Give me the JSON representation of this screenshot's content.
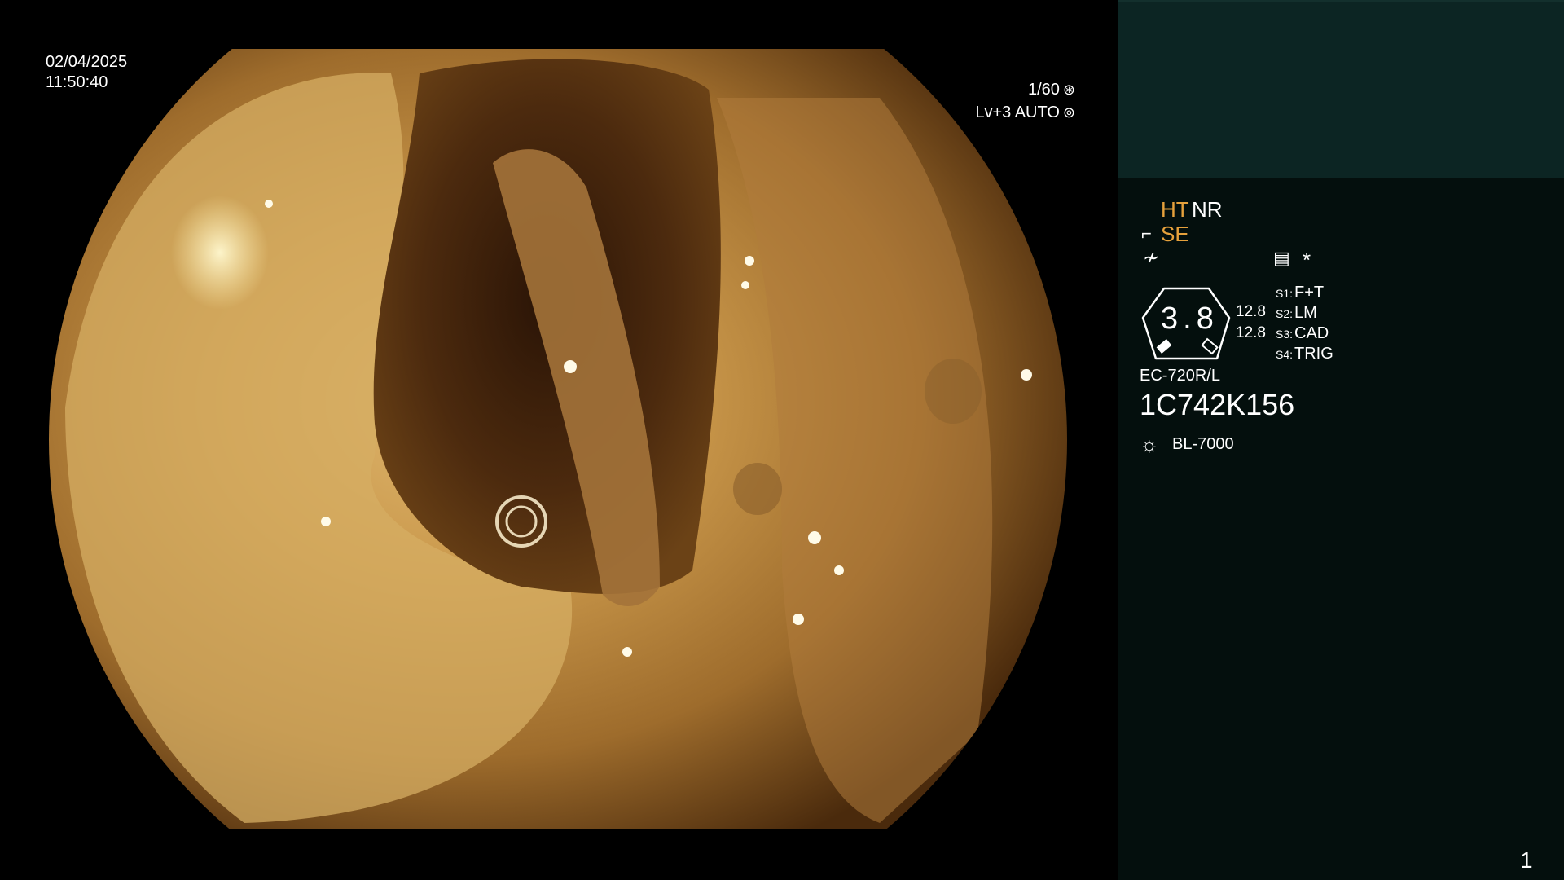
{
  "endoscope_view": {
    "date": "02/04/2025",
    "time": "11:50:40",
    "shutter": "1/60",
    "shutter_icon": "aperture-icon",
    "level": "Lv+3 AUTO",
    "level_icon": "iris-icon",
    "image_description_icon": "endoscopic-colon-view"
  },
  "side_panel": {
    "modes": {
      "ht": "HT",
      "nr": "NR",
      "se": "SE"
    },
    "gauge_value": "3.8",
    "values": [
      "12.8",
      "12.8"
    ],
    "switches": [
      {
        "key": "S1:",
        "value": "F+T"
      },
      {
        "key": "S2:",
        "value": "LM"
      },
      {
        "key": "S3:",
        "value": "CAD"
      },
      {
        "key": "S4:",
        "value": "TRIG"
      }
    ],
    "scope_model": "EC-720R/L",
    "serial": "1C742K156",
    "light_source": "BL-7000",
    "page_number": "1",
    "colors": {
      "accent": "#e6a13c",
      "panel_top": "#0c2523",
      "panel": "#040f0d"
    }
  }
}
